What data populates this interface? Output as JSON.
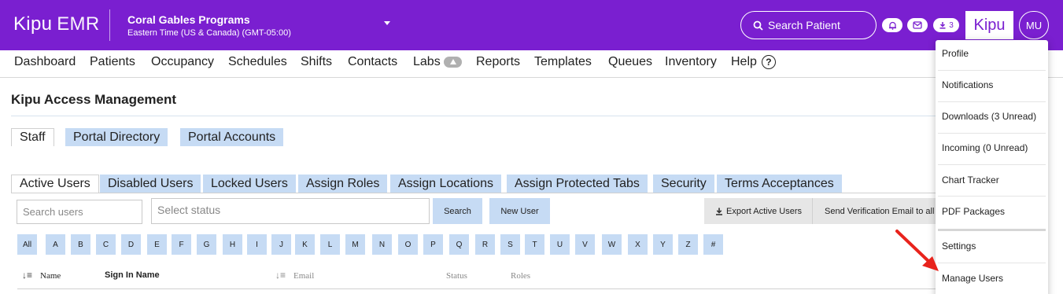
{
  "app": {
    "brand_primary": "Kipu",
    "brand_secondary": "EMR",
    "facility_name": "Coral Gables Programs",
    "facility_timezone": "Eastern Time (US & Canada) (GMT-05:00)",
    "search_placeholder": "Search Patient",
    "downloads_count": "3",
    "logo_text": "Kipu",
    "user_initials": "MU",
    "accent_color": "#7a1fd0"
  },
  "nav": {
    "items": [
      "Dashboard",
      "Patients",
      "Occupancy",
      "Schedules",
      "Shifts",
      "Contacts",
      "Labs",
      "Reports",
      "Templates",
      "Queues",
      "Inventory",
      "Help"
    ],
    "help_icon_glyph": "?"
  },
  "page": {
    "title": "Kipu Access Management",
    "top_tabs": [
      "Staff",
      "Portal Directory",
      "Portal Accounts"
    ],
    "sub_tabs": [
      "Active Users",
      "Disabled Users",
      "Locked Users",
      "Assign Roles",
      "Assign Locations",
      "Assign Protected Tabs",
      "Security",
      "Terms Acceptances"
    ]
  },
  "filters": {
    "search_placeholder": "Search users",
    "status_placeholder": "Select status",
    "search_button": "Search",
    "new_user_button": "New User",
    "export_button": "Export Active Users",
    "verification_button": "Send Verification Email to all u"
  },
  "letters": [
    "All",
    "A",
    "B",
    "C",
    "D",
    "E",
    "F",
    "G",
    "H",
    "I",
    "J",
    "K",
    "L",
    "M",
    "N",
    "O",
    "P",
    "Q",
    "R",
    "S",
    "T",
    "U",
    "V",
    "W",
    "X",
    "Y",
    "Z",
    "#"
  ],
  "table": {
    "headers": [
      "Name",
      "Sign In Name",
      "Email",
      "Status",
      "Roles"
    ]
  },
  "user_menu": {
    "items": [
      "Profile",
      "Notifications",
      "Downloads (3 Unread)",
      "Incoming (0 Unread)",
      "Chart Tracker",
      "PDF Packages",
      "Settings",
      "Manage Users"
    ]
  }
}
